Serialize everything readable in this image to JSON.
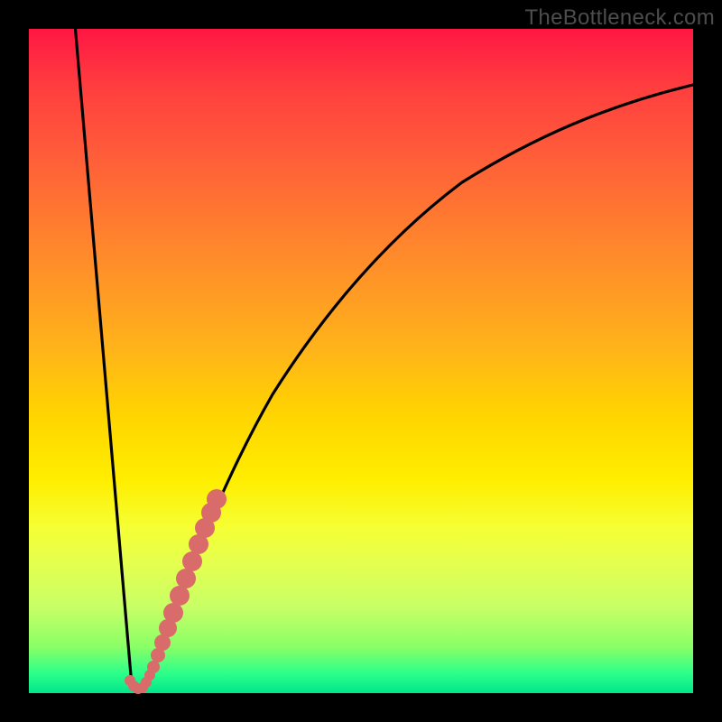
{
  "watermark": "TheBottleneck.com",
  "colors": {
    "frame": "#000000",
    "curve": "#000000",
    "marker": "#d96b6b",
    "gradient_top": "#ff1744",
    "gradient_bottom": "#00e68a"
  },
  "chart_data": {
    "type": "line",
    "title": "",
    "xlabel": "",
    "ylabel": "",
    "xlim": [
      0,
      100
    ],
    "ylim": [
      0,
      100
    ],
    "series": [
      {
        "name": "bottleneck-curve",
        "x": [
          7,
          8,
          9,
          10,
          11,
          12,
          13,
          14,
          15,
          16,
          17,
          18,
          20,
          22,
          25,
          28,
          32,
          36,
          40,
          45,
          50,
          55,
          60,
          65,
          70,
          75,
          80,
          85,
          90,
          95,
          100
        ],
        "y": [
          100,
          86,
          72,
          58,
          44,
          30,
          16,
          6,
          0,
          2,
          6,
          12,
          22,
          30,
          40,
          48,
          56,
          62,
          67,
          72,
          76,
          79,
          82,
          84,
          86,
          87.5,
          89,
          90,
          91,
          91.5,
          92
        ]
      }
    ],
    "markers": [
      {
        "name": "highlight-segment",
        "x": [
          14.0,
          14.5,
          15.0,
          15.5,
          16.0,
          17.0,
          18.0,
          19.0,
          20.0,
          21.0,
          22.0,
          23.0
        ],
        "y": [
          3.0,
          1.5,
          0.5,
          1.0,
          2.5,
          6.5,
          11.5,
          16.5,
          21.5,
          25.5,
          29.5,
          33.0
        ]
      }
    ]
  }
}
